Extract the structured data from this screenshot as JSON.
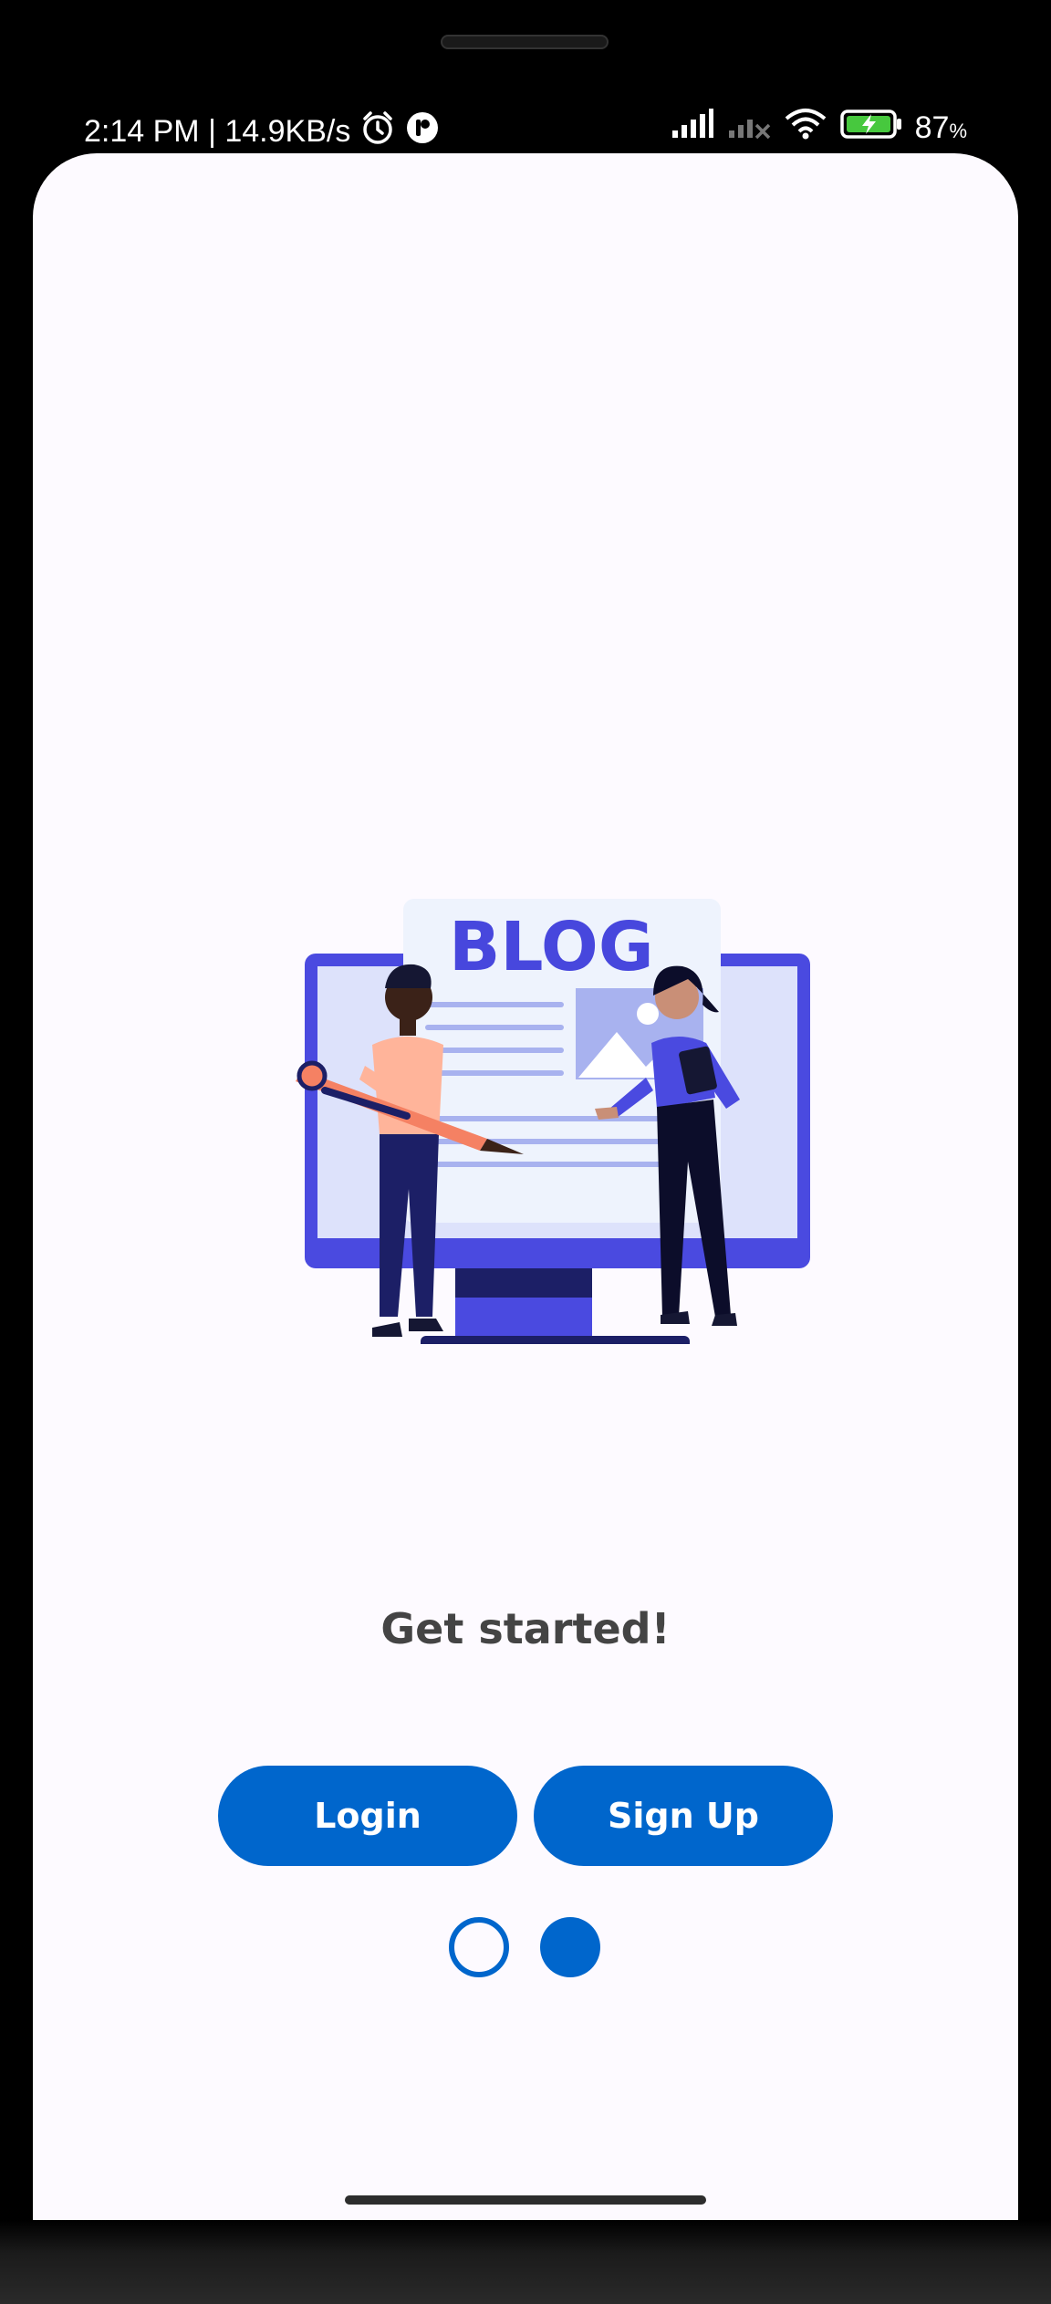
{
  "status_bar": {
    "time_speed": "2:14 PM | 14.9KB/s",
    "battery": "87",
    "battery_unit": "%",
    "icons": [
      "alarm-icon",
      "app-notification-icon",
      "signal-icon",
      "no-signal-icon",
      "wifi-icon",
      "battery-charging-icon"
    ]
  },
  "main": {
    "title": "Get started!",
    "illustration_text": "BLOG",
    "login_label": "Login",
    "signup_label": "Sign Up"
  },
  "pager": {
    "count": 2,
    "active_index": 1
  },
  "colors": {
    "primary": "#0066cc",
    "background": "#fdfaff",
    "title": "#444444",
    "illustration_blue": "#4a4ae0",
    "illustration_navy": "#1c1f66"
  }
}
